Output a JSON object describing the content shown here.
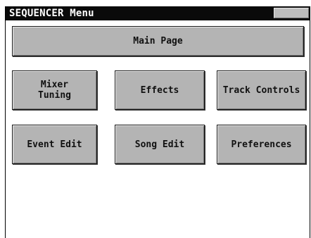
{
  "window": {
    "title": "SEQUENCER Menu"
  },
  "buttons": {
    "main_page": "Main Page",
    "mixer_tuning": "Mixer\nTuning",
    "effects": "Effects",
    "track_controls": "Track Controls",
    "event_edit": "Event Edit",
    "song_edit": "Song Edit",
    "preferences": "Preferences"
  },
  "colors": {
    "titlebar": "#0a0a0a",
    "button_face": "#b4b4b4",
    "background": "#ffffff"
  }
}
